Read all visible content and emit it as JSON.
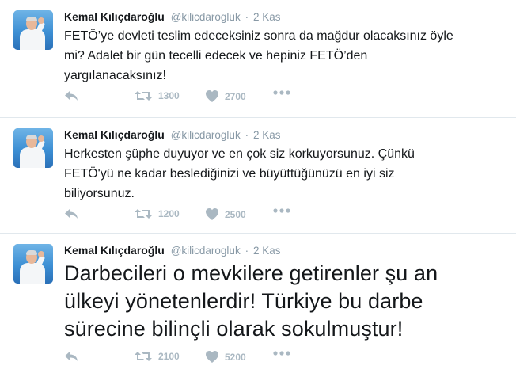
{
  "tweets": [
    {
      "author_name": "Kemal Kılıçdaroğlu",
      "handle": "@kilicdarogluk",
      "separator": "·",
      "time": "2 Kas",
      "text": "FETÖ’ye devleti teslim edeceksiniz sonra da mağdur olacaksınız öyle\nmi? Adalet bir gün tecelli edecek ve hepiniz FETÖ’den\nyargılanacaksınız!",
      "retweets": "1300",
      "likes": "2700"
    },
    {
      "author_name": "Kemal Kılıçdaroğlu",
      "handle": "@kilicdarogluk",
      "separator": "·",
      "time": "2 Kas",
      "text": "Herkesten şüphe duyuyor ve en çok siz korkuyorsunuz. Çünkü\nFETÖ'yü ne kadar beslediğinizi ve büyüttüğünüzü en iyi siz\nbiliyorsunuz.",
      "retweets": "1200",
      "likes": "2500"
    },
    {
      "author_name": "Kemal Kılıçdaroğlu",
      "handle": "@kilicdarogluk",
      "separator": "·",
      "time": "2 Kas",
      "text": "Darbecileri o mevkilere getirenler şu an\nülkeyi yönetenlerdir! Türkiye bu darbe\nsürecine bilinçli olarak sokulmuştur!",
      "retweets": "2100",
      "likes": "5200"
    }
  ],
  "icons": {
    "reply": "reply-icon",
    "retweet": "retweet-icon",
    "like": "heart-icon",
    "more": "more-dots-icon"
  },
  "colors": {
    "text": "#14171a",
    "muted": "#8899a6",
    "action": "#aab8c2",
    "divider": "#e1e8ed"
  }
}
